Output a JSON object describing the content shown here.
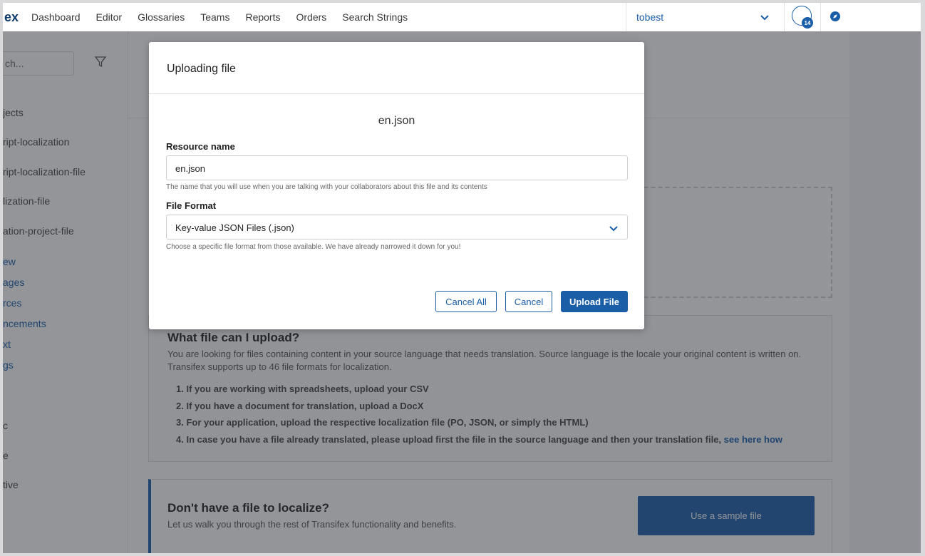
{
  "nav": {
    "logo": "ex",
    "items": [
      "Dashboard",
      "Editor",
      "Glossaries",
      "Teams",
      "Reports",
      "Orders",
      "Search Strings"
    ],
    "org": "tobest",
    "notification_count": "14"
  },
  "sidebar": {
    "search_placeholder": "ch...",
    "items": [
      "jects",
      "ript-localization",
      "ript-localization-file",
      "lization-file",
      "ation-project-file"
    ],
    "links": [
      "ew",
      "ages",
      "rces",
      "ncements",
      "xt",
      "gs"
    ],
    "more": [
      "c",
      "e",
      "tive"
    ]
  },
  "info": {
    "title": "What file can I upload?",
    "text": "You are looking for files containing content in your source language that needs translation. Source language is the locale your original content is written on. Transifex supports up to 46 file formats for localization.",
    "list": [
      "1. If you are working with spreadsheets, upload your CSV",
      "2. If you have a document for translation, upload a DocX",
      "3. For your application, upload the respective localization file (PO, JSON, or simply the HTML)",
      "4. In case you have a file already translated, please upload first the file in the source language and then your translation file,"
    ],
    "link": "see here how"
  },
  "sample": {
    "title": "Don't have a file to localize?",
    "text": "Let us walk you through the rest of Transifex functionality and benefits.",
    "button": "Use a sample file"
  },
  "modal": {
    "title": "Uploading file",
    "file_name": "en.json",
    "resource_label": "Resource name",
    "resource_value": "en.json",
    "resource_hint": "The name that you will use when you are talking with your collaborators about this file and its contents",
    "format_label": "File Format",
    "format_value": "Key-value JSON Files (.json)",
    "format_hint": "Choose a specific file format from those available. We have already narrowed it down for you!",
    "cancel_all": "Cancel All",
    "cancel": "Cancel",
    "upload": "Upload File"
  }
}
